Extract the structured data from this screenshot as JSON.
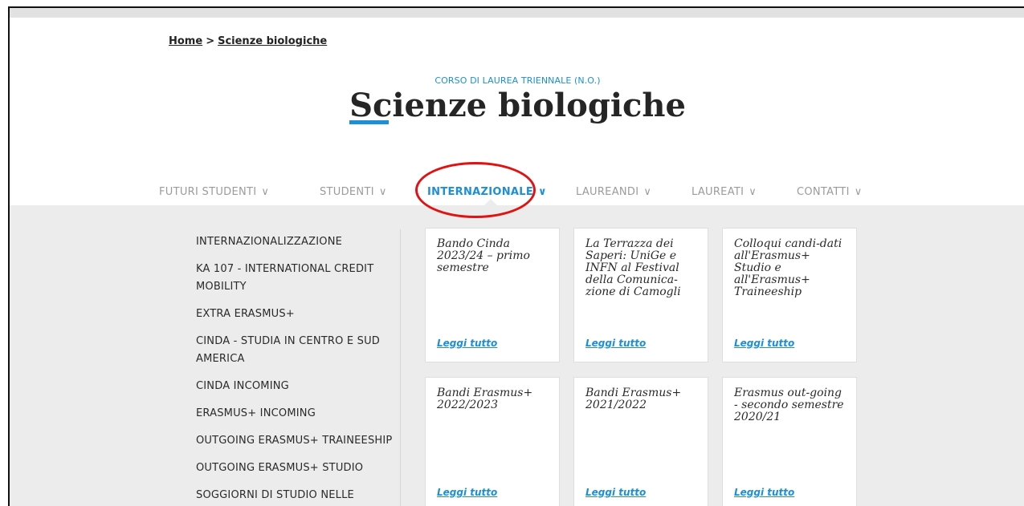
{
  "breadcrumb": {
    "home": "Home",
    "sep": ">",
    "current": "Scienze biologiche"
  },
  "header": {
    "subtitle": "CORSO DI LAUREA TRIENNALE (N.O.)",
    "title_underlined": "Sc",
    "title_rest": "ienze biologiche"
  },
  "nav": {
    "chevron": "∨",
    "items": [
      {
        "label": "FUTURI STUDENTI"
      },
      {
        "label": "STUDENTI"
      },
      {
        "label": "INTERNAZIONALE"
      },
      {
        "label": "LAUREANDI"
      },
      {
        "label": "LAUREATI"
      },
      {
        "label": "CONTATTI"
      }
    ],
    "active_index": 2
  },
  "submenu": [
    "INTERNAZIONALIZZAZIONE",
    "KA 107 - INTERNATIONAL CREDIT MOBILITY",
    "EXTRA ERASMUS+",
    "CINDA - STUDIA IN CENTRO E SUD AMERICA",
    "CINDA INCOMING",
    "ERASMUS+ INCOMING",
    "OUTGOING ERASMUS+ TRAINEESHIP",
    "OUTGOING ERASMUS+ STUDIO",
    "SOGGIORNI DI STUDIO NELLE"
  ],
  "cards": [
    {
      "title": "Bando Cinda 2023/24 – primo semestre",
      "more": "Leggi tutto"
    },
    {
      "title": "La Terrazza dei Saperi: UniGe e INFN al Festival della Comunica-zione di Camogli",
      "more": "Leggi tutto"
    },
    {
      "title": "Colloqui candi-dati all'Erasmus+ Studio e all'Erasmus+ Traineeship",
      "more": "Leggi tutto"
    },
    {
      "title": "Bandi Erasmus+ 2022/2023",
      "more": "Leggi tutto"
    },
    {
      "title": "Bandi Erasmus+ 2021/2022",
      "more": "Leggi tutto"
    },
    {
      "title": "Erasmus out-going - secondo semestre 2020/21",
      "more": "Leggi tutto"
    }
  ],
  "colors": {
    "accent": "#1c8fd6",
    "highlight_circle": "#e01212",
    "panel_bg": "#ececec"
  }
}
